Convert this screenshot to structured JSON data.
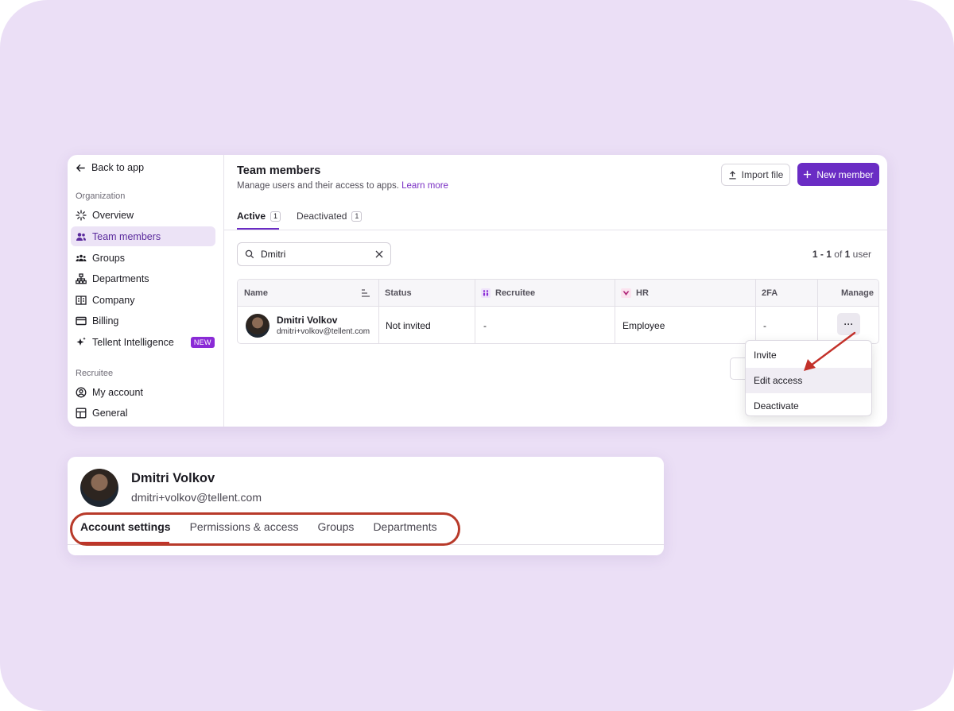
{
  "sidebar": {
    "back_label": "Back to app",
    "section_org": "Organization",
    "org_items": [
      {
        "label": "Overview",
        "icon": "sparkle-icon"
      },
      {
        "label": "Team members",
        "icon": "users-icon",
        "active": true
      },
      {
        "label": "Groups",
        "icon": "group-icon"
      },
      {
        "label": "Departments",
        "icon": "hierarchy-icon"
      },
      {
        "label": "Company",
        "icon": "building-icon"
      },
      {
        "label": "Billing",
        "icon": "card-icon"
      },
      {
        "label": "Tellent Intelligence",
        "icon": "ai-sparkle-icon",
        "badge": "NEW"
      }
    ],
    "section_recruitee": "Recruitee",
    "recruitee_items": [
      {
        "label": "My account",
        "icon": "user-circle-icon"
      },
      {
        "label": "General",
        "icon": "layout-icon"
      }
    ]
  },
  "header": {
    "title": "Team members",
    "subtitle": "Manage users and their access to apps.",
    "learn_more": "Learn more",
    "import_label": "Import file",
    "new_member_label": "New member"
  },
  "tabs": [
    {
      "label": "Active",
      "count": "1"
    },
    {
      "label": "Deactivated",
      "count": "1"
    }
  ],
  "search": {
    "value": "Dmitri"
  },
  "pager": {
    "range": "1 - 1",
    "of": "of",
    "total": "1",
    "unit": "user"
  },
  "table": {
    "headers": [
      "Name",
      "Status",
      "Recruitee",
      "HR",
      "2FA",
      "Manage"
    ],
    "row": {
      "name": "Dmitri Volkov",
      "email": "dmitri+volkov@tellent.com",
      "status": "Not invited",
      "recruitee": "-",
      "hr": "Employee",
      "twofa": "-"
    },
    "more_label": "···"
  },
  "menu": [
    "Invite",
    "Edit access",
    "Deactivate"
  ],
  "profile": {
    "name": "Dmitri Volkov",
    "email": "dmitri+volkov@tellent.com",
    "tabs": [
      "Account settings",
      "Permissions & access",
      "Groups",
      "Departments"
    ]
  },
  "colors": {
    "accent": "#6a2cc4",
    "background": "#ebdff6",
    "annotation": "#c3312a"
  }
}
